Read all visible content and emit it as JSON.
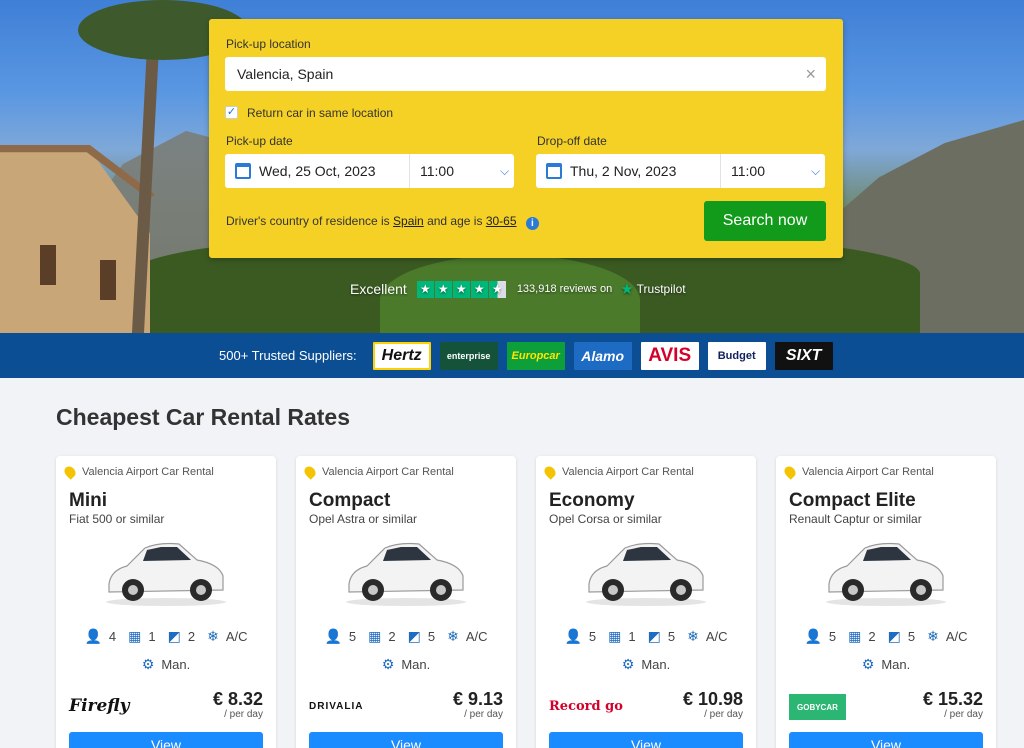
{
  "search": {
    "pickup_label": "Pick-up location",
    "pickup_value": "Valencia, Spain",
    "return_same_label": "Return car in same location",
    "pickup_date_label": "Pick-up date",
    "pickup_date": "Wed, 25 Oct, 2023",
    "pickup_time": "11:00",
    "dropoff_date_label": "Drop-off date",
    "dropoff_date": "Thu, 2 Nov, 2023",
    "dropoff_time": "11:00",
    "residence_prefix": "Driver's country of residence is",
    "residence_country": "Spain",
    "residence_mid": "and age is",
    "residence_age": "30-65",
    "search_button": "Search now"
  },
  "trust": {
    "rating": "Excellent",
    "reviews": "133,918 reviews on",
    "brand": "Trustpilot"
  },
  "suppliers": {
    "label": "500+ Trusted Suppliers:",
    "logos": [
      "Hertz",
      "enterprise",
      "Europcar",
      "Alamo",
      "AVIS",
      "Budget",
      "SIXT"
    ]
  },
  "section_title": "Cheapest Car Rental Rates",
  "cards": [
    {
      "location": "Valencia Airport Car Rental",
      "class": "Mini",
      "model": "Fiat 500 or similar",
      "seats": "4",
      "bags": "1",
      "doors": "2",
      "ac": "A/C",
      "transmission": "Man.",
      "supplier": "Firefly",
      "price": "€ 8.32",
      "per": "/ per day",
      "view": "View"
    },
    {
      "location": "Valencia Airport Car Rental",
      "class": "Compact",
      "model": "Opel Astra or similar",
      "seats": "5",
      "bags": "2",
      "doors": "5",
      "ac": "A/C",
      "transmission": "Man.",
      "supplier": "DRIVALIA",
      "price": "€ 9.13",
      "per": "/ per day",
      "view": "View"
    },
    {
      "location": "Valencia Airport Car Rental",
      "class": "Economy",
      "model": "Opel Corsa or similar",
      "seats": "5",
      "bags": "1",
      "doors": "5",
      "ac": "A/C",
      "transmission": "Man.",
      "supplier": "Record go",
      "price": "€ 10.98",
      "per": "/ per day",
      "view": "View"
    },
    {
      "location": "Valencia Airport Car Rental",
      "class": "Compact Elite",
      "model": "Renault Captur or similar",
      "seats": "5",
      "bags": "2",
      "doors": "5",
      "ac": "A/C",
      "transmission": "Man.",
      "supplier": "GOBYCAR",
      "price": "€ 15.32",
      "per": "/ per day",
      "view": "View"
    }
  ],
  "colors": {
    "panel": "#f5d126",
    "search_button": "#129b1b",
    "supplier_bar": "#0b4e93",
    "view_button": "#1a8cff",
    "trustpilot": "#00b67a"
  }
}
